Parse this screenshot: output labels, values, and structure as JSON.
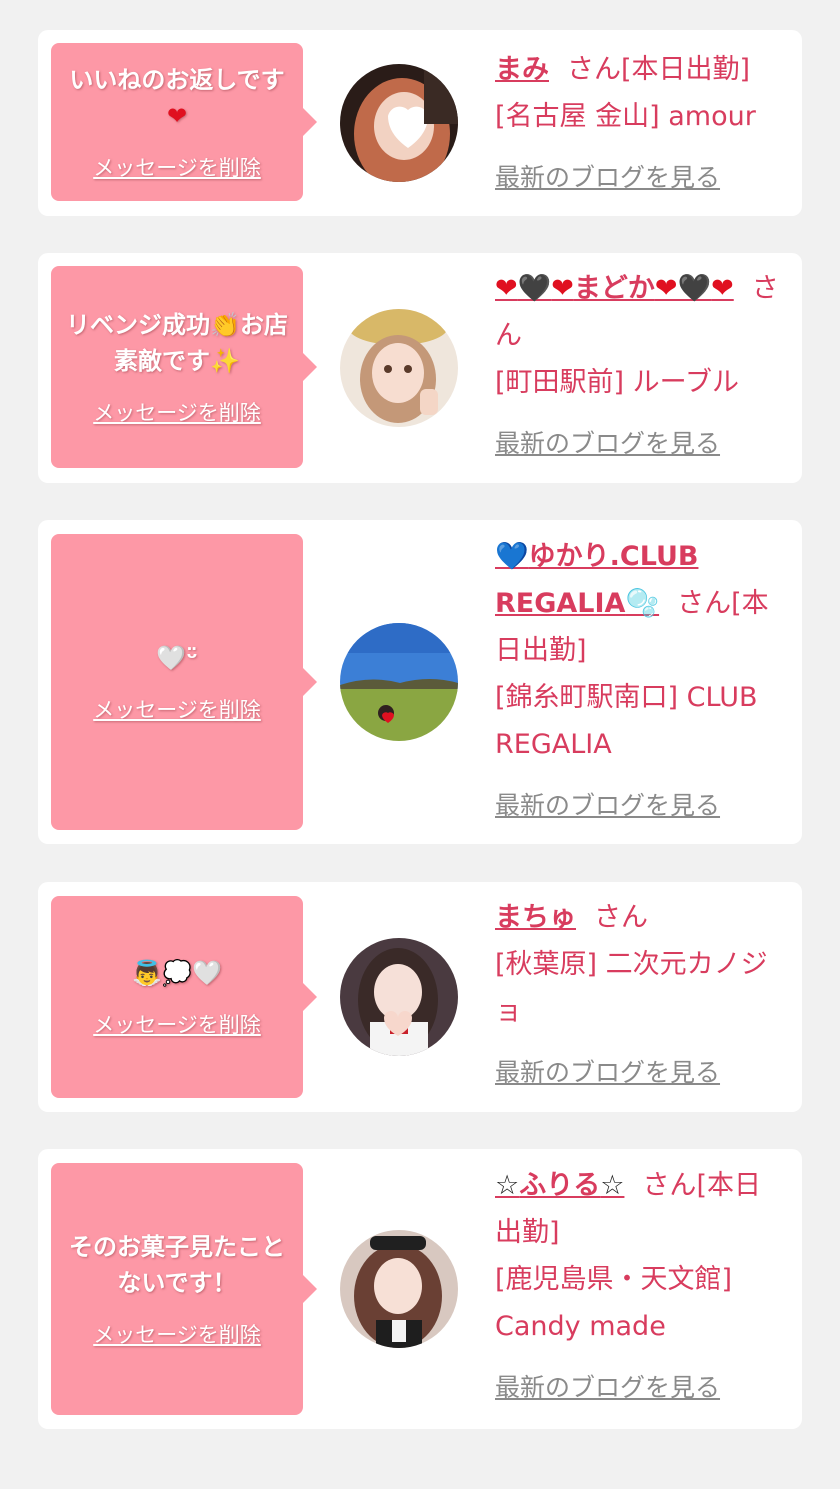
{
  "delete_label": "メッセージを削除",
  "blog_label": "最新のブログを見る",
  "san_label": "さん",
  "cards": [
    {
      "message": "いいねのお返しです",
      "message_emoji": "❤",
      "name": "まみ",
      "status": "[本日出勤]",
      "shop": "[名古屋 金山] amour"
    },
    {
      "message": "リベンジ成功",
      "message_emoji": "👏",
      "message_tail": "お店素敵です",
      "message_emoji2": "✨",
      "name_parts": [
        "❤",
        "🖤",
        "❤",
        "まどか",
        "❤",
        "🖤",
        "❤"
      ],
      "shop": "[町田駅前] ルーブル"
    },
    {
      "message": "🤍",
      "message_emoji": "ᵕ̈",
      "name_prefix": "💙",
      "name": "ゆかり.CLUB REGALIA",
      "name_suffix": "🫧",
      "status": "[本日出勤]",
      "shop": "[錦糸町駅南口] CLUB REGALIA"
    },
    {
      "message": "👼💭🤍",
      "name": "まちゅ",
      "status": "",
      "shop": "[秋葉原] 二次元カノジョ"
    },
    {
      "message": "そのお菓子見たことないです！",
      "name_prefix": "☆",
      "name": "ふりる",
      "name_suffix": "☆",
      "status": "[本日出勤]",
      "shop": "[鹿児島県・天文館] Candy made"
    }
  ]
}
